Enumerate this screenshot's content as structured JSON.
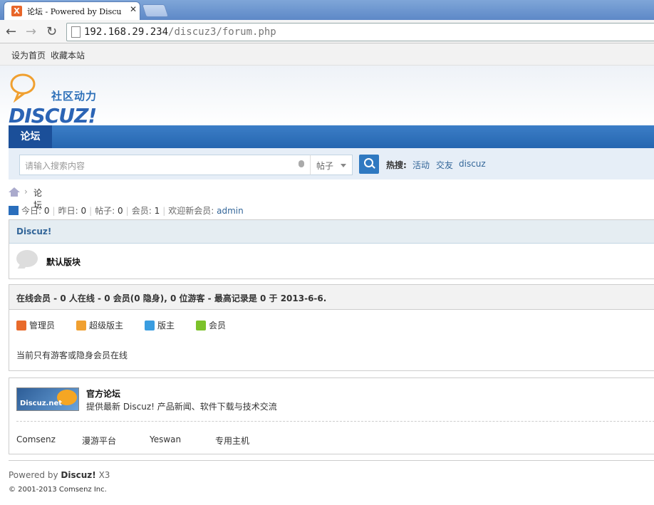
{
  "browser": {
    "tab_title": "论坛 - Powered by Discu",
    "favicon_letter": "X",
    "close_glyph": "✕",
    "url_host": "192.168.29.234",
    "url_path": "/discuz3/forum.php"
  },
  "bookmarks": {
    "set_home": "设为首页",
    "favorite": "收藏本站"
  },
  "logo": {
    "tagline": "社区动力",
    "wordmark": "DISCUZ!"
  },
  "nav": {
    "active": "论坛"
  },
  "search": {
    "placeholder": "请输入搜索内容",
    "type": "帖子",
    "hot_label": "热搜:",
    "hot_terms": [
      "活动",
      "交友",
      "discuz"
    ]
  },
  "breadcrumb": {
    "sep": "›",
    "current": "论坛"
  },
  "stats": {
    "today_label": "今日:",
    "today": "0",
    "yesterday_label": "昨日:",
    "yesterday": "0",
    "posts_label": "帖子:",
    "posts": "0",
    "members_label": "会员:",
    "members": "1",
    "welcome_label": "欢迎新会员:",
    "newest": "admin"
  },
  "category": {
    "title": "Discuz!",
    "forum_name": "默认版块"
  },
  "online": {
    "title": "在线会员 - 0 人在线 - 0 会员(0 隐身), 0 位游客 - 最高记录是 0 于 2013-6-6.",
    "legend": [
      "管理员",
      "超级版主",
      "版主",
      "会员"
    ],
    "legend_colors": [
      "#e86a2b",
      "#f0a030",
      "#3a9de0",
      "#7cc22a"
    ],
    "message": "当前只有游客或隐身会员在线"
  },
  "partners": {
    "logo_text": "Discuz.net",
    "title": "官方论坛",
    "desc": "提供最新 Discuz! 产品新闻、软件下载与技术交流",
    "links": [
      "Comsenz",
      "漫游平台",
      "Yeswan",
      "专用主机"
    ]
  },
  "footer": {
    "powered_prefix": "Powered by",
    "brand": "Discuz!",
    "version": "X3",
    "copyright": "© 2001-2013 Comsenz Inc."
  }
}
